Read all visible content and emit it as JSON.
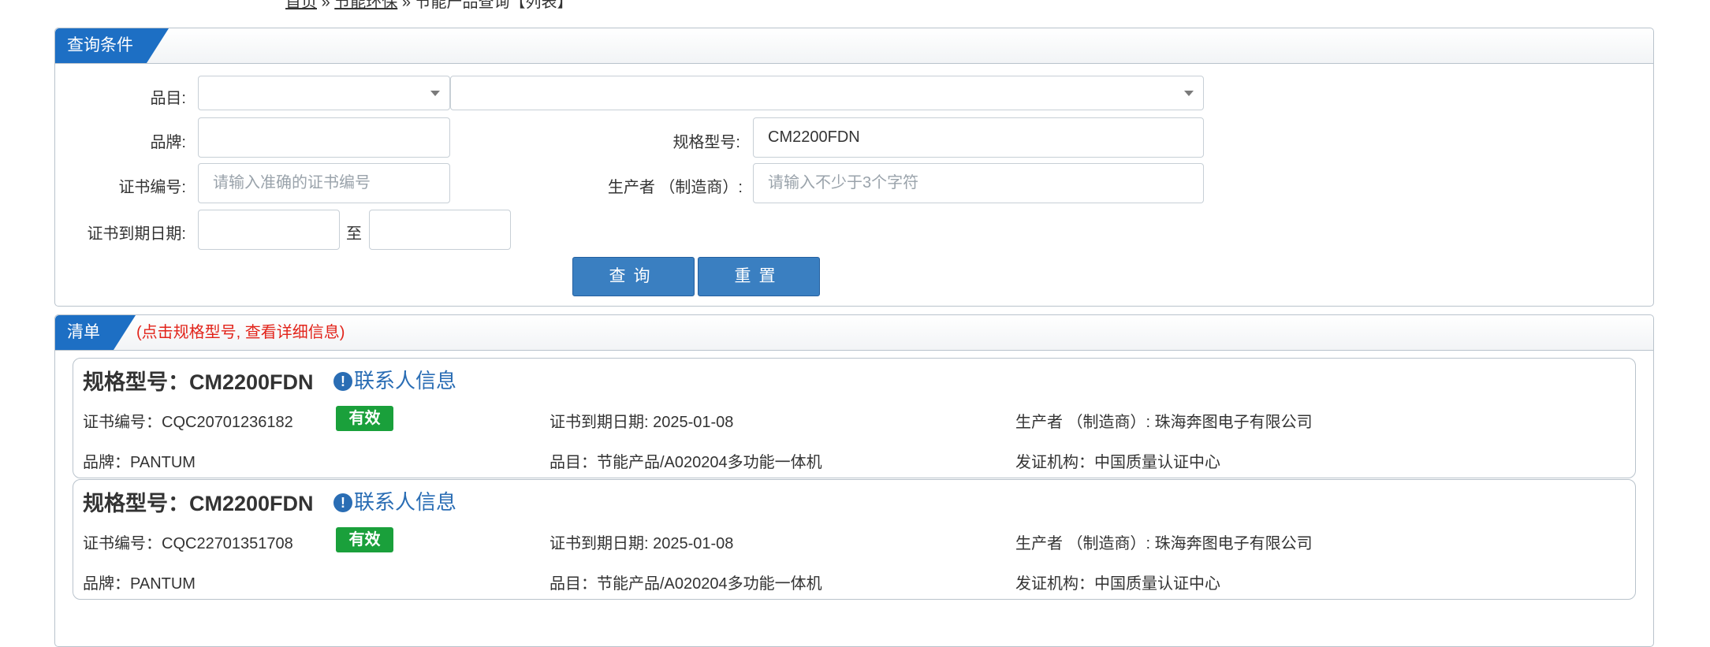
{
  "breadcrumb": {
    "home": "首页",
    "sep": "»",
    "section": "节能环保",
    "current": "节能产品查询【列表】"
  },
  "query_panel": {
    "title": "查询条件",
    "labels": {
      "category": "品目:",
      "brand": "品牌:",
      "model": "规格型号:",
      "cert_no": "证书编号:",
      "manufacturer": "生产者 （制造商）:",
      "expiry": "证书到期日期:",
      "to": "至"
    },
    "fields": {
      "category_1": "",
      "category_2": "",
      "brand": "",
      "model": "CM2200FDN",
      "cert_no_placeholder": "请输入准确的证书编号",
      "manufacturer_placeholder": "请输入不少于3个字符",
      "expiry_from": "",
      "expiry_to": ""
    },
    "buttons": {
      "search": "查询",
      "reset": "重置"
    }
  },
  "list_panel": {
    "title": "清单",
    "hint": "(点击规格型号, 查看详细信息)",
    "items": [
      {
        "model_title": "规格型号：CM2200FDN",
        "contact": "联系人信息",
        "cert_no": "证书编号：CQC20701236182",
        "status": "有效",
        "expiry": "证书到期日期: 2025-01-08",
        "manufacturer": "生产者 （制造商）: 珠海奔图电子有限公司",
        "brand": "品牌：PANTUM",
        "category": "品目：节能产品/A020204多功能一体机",
        "issuer": "发证机构：中国质量认证中心"
      },
      {
        "model_title": "规格型号：CM2200FDN",
        "contact": "联系人信息",
        "cert_no": "证书编号：CQC22701351708",
        "status": "有效",
        "expiry": "证书到期日期: 2025-01-08",
        "manufacturer": "生产者 （制造商）: 珠海奔图电子有限公司",
        "brand": "品牌：PANTUM",
        "category": "品目：节能产品/A020204多功能一体机",
        "issuer": "发证机构：中国质量认证中心"
      }
    ]
  },
  "colors": {
    "primary": "#1d6fc4",
    "button": "#3a7fc1",
    "valid_badge": "#1aa03b",
    "hint": "#e2231a",
    "link": "#2a6db4"
  }
}
